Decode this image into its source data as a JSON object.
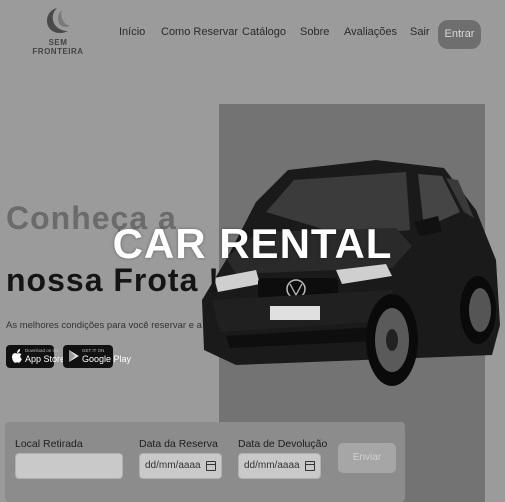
{
  "header": {
    "logo_text": "SEM FRONTEIRA",
    "nav": [
      "Início",
      "Como Reservar",
      "Catálogo",
      "Sobre",
      "Avaliações",
      "Sair"
    ],
    "login_label": "Entrar"
  },
  "hero": {
    "title_line1": "Conheça a",
    "title_line2": "nossa Frota !",
    "subtitle": "As melhores condições para você reservar e apr",
    "overlay_title": "CAR RENTAL",
    "app_store": {
      "small": "Download on the",
      "big": "App Store"
    },
    "google_play": {
      "small": "GET IT ON",
      "big": "Google Play"
    }
  },
  "form": {
    "pickup_label": "Local Retirada",
    "pickup_value": "",
    "reserve_date_label": "Data da Reserva",
    "reserve_date_value": "dd/mm/aaaa",
    "return_date_label": "Data de Devolução",
    "return_date_value": "dd/mm/aaaa",
    "submit_label": "Enviar"
  }
}
